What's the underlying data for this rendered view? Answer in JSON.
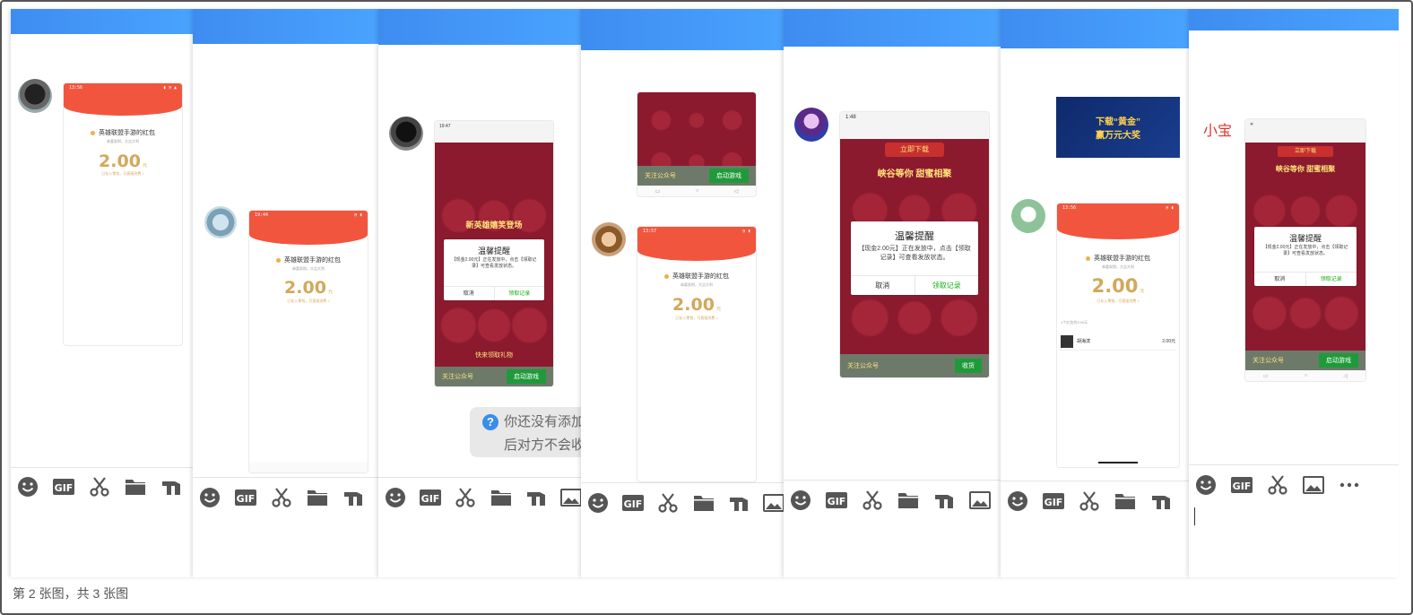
{
  "footer": {
    "caption": "第 2 张图，共 3 张图"
  },
  "red_packet": {
    "title": "英雄联盟手游的红包",
    "subtitle": "恭喜发财，大吉大利",
    "amount": "2.00",
    "unit": "元",
    "link": "已存入零钱，可直接消费 >",
    "status_time": "13:56",
    "status_time_b": "19:44",
    "status_time_c": "13:57",
    "status_time_d": "13:56"
  },
  "dialog": {
    "title": "温馨提醒",
    "body": "【现金2.00元】正在发放中，点击【领取记录】可查看发放状态。",
    "cancel": "取消",
    "confirm": "领取记录"
  },
  "game": {
    "follow": "关注公众号",
    "start": "启动游戏",
    "receive": "收货",
    "download": "立即下载",
    "headline": "峡谷等你 甜蜜相聚",
    "banner_a": "新英雄嬉笑登场",
    "banner_b": "快来领取礼物"
  },
  "ad_banner": {
    "text": "下载“黄金”",
    "text2": "赢万元大奖"
  },
  "notice": {
    "line1": "你还没有添加",
    "line2": "后对方不会收"
  },
  "chat": {
    "name_red": "小宝",
    "receiver": "胡海滨",
    "receiver_amount": "2.00元",
    "count": "1个红包共2.00元"
  },
  "toolbar": {
    "emoji": "emoji-icon",
    "gif": "GIF",
    "scissors": "scissors-icon",
    "folder": "folder-icon",
    "shake": "shake-icon",
    "image": "image-icon",
    "more": "more-icon"
  },
  "colors": {
    "accent_blue": "#3e8cf0",
    "packet_red": "#f2553e",
    "gold": "#d3a85a",
    "wechat_green": "#1aad19",
    "game_red": "#8b1a2e"
  }
}
